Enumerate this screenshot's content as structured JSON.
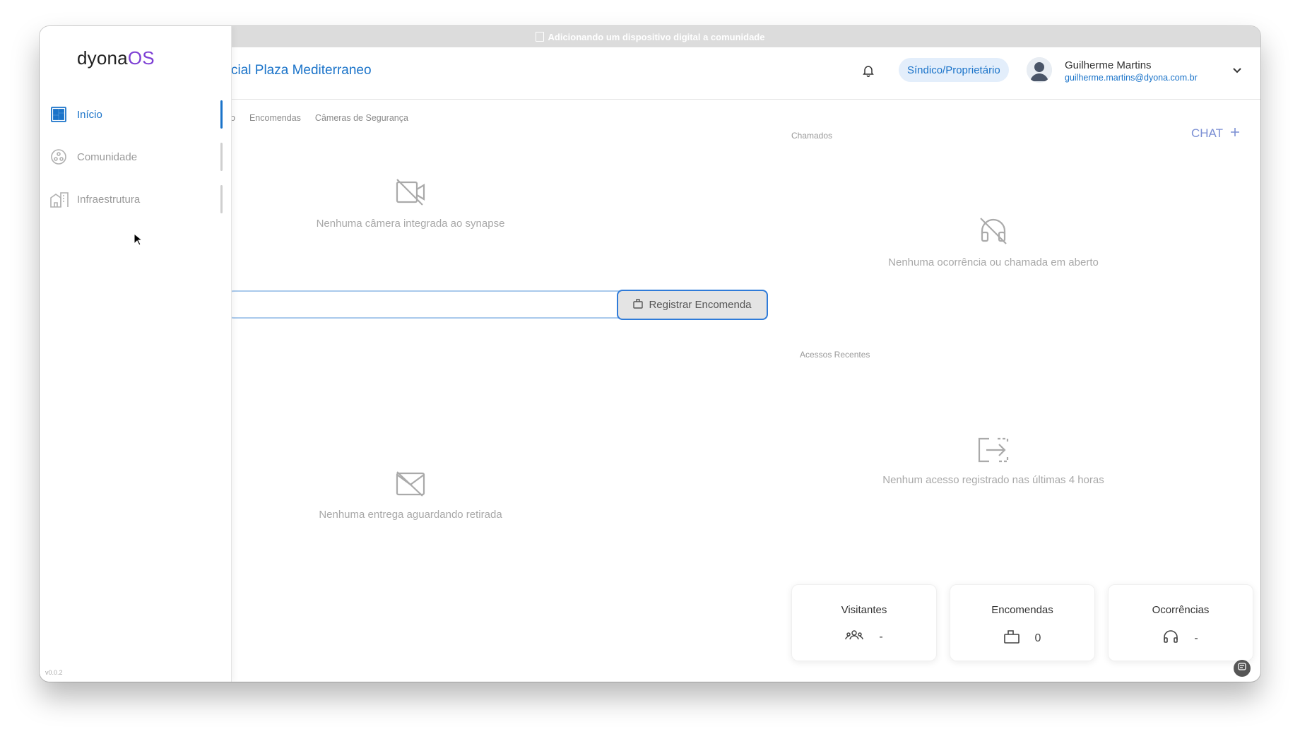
{
  "window": {
    "title": "Adicionando um dispositivo digital a comunidade"
  },
  "sidebar": {
    "logo_main": "dyona",
    "logo_accent": "OS",
    "items": [
      {
        "label": "Início",
        "icon": "dashboard-icon",
        "active": true
      },
      {
        "label": "Comunidade",
        "icon": "community-icon",
        "active": false
      },
      {
        "label": "Infraestrutura",
        "icon": "buildings-icon",
        "active": false
      }
    ],
    "version": "v0.0.2"
  },
  "header": {
    "condo_name": "cial Plaza Mediterraneo",
    "role": "Síndico/Proprietário",
    "user_name": "Guilherme Martins",
    "user_email": "guilherme.martins@dyona.com.br"
  },
  "tabs": [
    "o",
    "Encomendas",
    "Câmeras de Segurança"
  ],
  "sections": {
    "chamados_label": "Chamados",
    "chat_label": "CHAT",
    "acessos_label": "Acessos Recentes"
  },
  "empty_states": {
    "cameras": "Nenhuma câmera integrada ao synapse",
    "chamados": "Nenhuma ocorrência ou chamada em aberto",
    "entregas": "Nenhuma entrega aguardando retirada",
    "acessos": "Nenhum acesso registrado nas últimas 4 horas"
  },
  "register_button": "Registrar Encomenda",
  "stats": [
    {
      "title": "Visitantes",
      "value": "-",
      "icon": "visitors-icon"
    },
    {
      "title": "Encomendas",
      "value": "0",
      "icon": "package-icon"
    },
    {
      "title": "Ocorrências",
      "value": "-",
      "icon": "support-icon"
    }
  ],
  "colors": {
    "accent": "#1a73c9",
    "brand_purple": "#7d3fd4",
    "muted": "#a8a8a8"
  }
}
